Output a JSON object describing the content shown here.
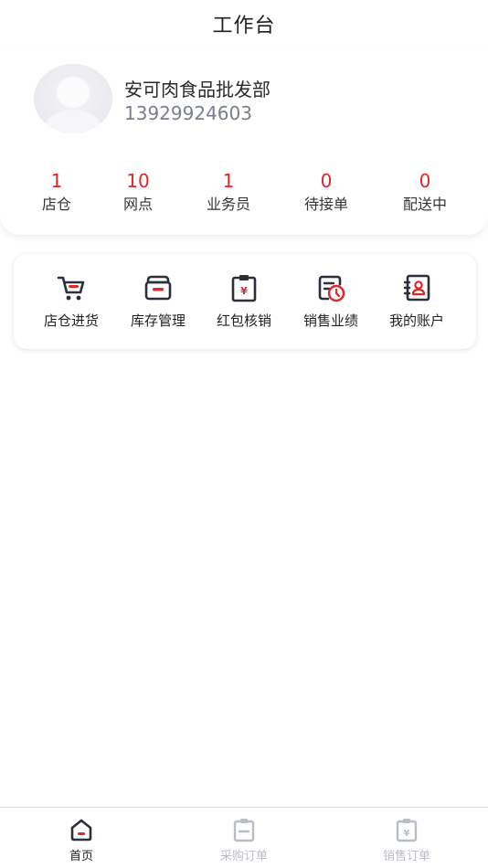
{
  "header": {
    "title": "工作台"
  },
  "profile": {
    "shop_name": "安可肉食品批发部",
    "phone": "13929924603"
  },
  "stats": [
    {
      "value": "1",
      "label": "店仓"
    },
    {
      "value": "10",
      "label": "网点"
    },
    {
      "value": "1",
      "label": "业务员"
    },
    {
      "value": "0",
      "label": "待接单"
    },
    {
      "value": "0",
      "label": "配送中"
    }
  ],
  "tools": [
    {
      "label": "店仓进货",
      "icon": "cart-icon"
    },
    {
      "label": "库存管理",
      "icon": "inventory-box-icon"
    },
    {
      "label": "红包核销",
      "icon": "red-packet-clipboard-icon"
    },
    {
      "label": "销售业绩",
      "icon": "sales-report-clock-icon"
    },
    {
      "label": "我的账户",
      "icon": "account-card-icon"
    }
  ],
  "tabbar": [
    {
      "label": "首页",
      "icon": "home-icon",
      "active": true
    },
    {
      "label": "采购订单",
      "icon": "purchase-order-icon",
      "active": false
    },
    {
      "label": "销售订单",
      "icon": "sales-order-icon",
      "active": false
    }
  ],
  "colors": {
    "accent_red": "#e0262b",
    "icon_dark": "#2b2f3a",
    "tab_inactive": "#b8bcc6"
  }
}
